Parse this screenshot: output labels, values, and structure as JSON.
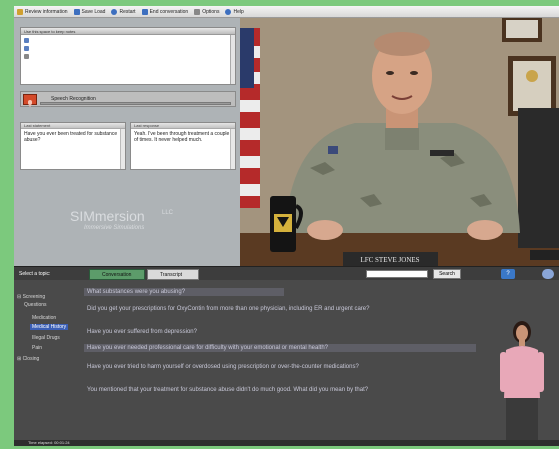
{
  "toolbar": {
    "items": [
      {
        "label": "Review information",
        "icon": "document-icon",
        "color": "#d0a030"
      },
      {
        "label": "Save Load",
        "icon": "disk-icon",
        "color": "#3d6fbf"
      },
      {
        "label": "Restart",
        "icon": "refresh-icon",
        "color": "#3d6fbf"
      },
      {
        "label": "End conversation",
        "icon": "stop-icon",
        "color": "#3d6fbf"
      },
      {
        "label": "Options",
        "icon": "wrench-icon",
        "color": "#888888"
      },
      {
        "label": "Help",
        "icon": "help-icon",
        "color": "#3d6fbf"
      }
    ]
  },
  "notes": {
    "header": "Use this space to keep notes"
  },
  "speech": {
    "label": "Speech Recognition"
  },
  "last_said": {
    "user_header": "Last statement",
    "user_text": "Have you ever been treated for substance abuse?",
    "char_header": "Last response",
    "char_text": "Yeah. I've been through treatment a couple of times. It never helped much."
  },
  "logo": {
    "name": "SIMmersion",
    "suffix": "LLC",
    "tagline": "Immersive Simulations"
  },
  "video": {
    "nameplate": "LFC STEVE JONES"
  },
  "dialog": {
    "topic_label": "Select a topic:",
    "tabs": [
      "Conversation",
      "Transcript"
    ],
    "search_label": "Search",
    "help_label": "?"
  },
  "tree": {
    "items": [
      {
        "label": "⊟ Screening"
      },
      {
        "label": "Questions"
      },
      {
        "label": "Medication"
      },
      {
        "label": "Medical History"
      },
      {
        "label": "Illegal Drugs"
      },
      {
        "label": "Pain"
      },
      {
        "label": "⊞ Closing"
      }
    ]
  },
  "questions": [
    "What substances were you abusing?",
    "Did you get your prescriptions for OxyContin from more than one physician, including ER and urgent care?",
    "Have you ever suffered from depression?",
    "Have you ever needed professional care for difficulty with your emotional or mental health?",
    "Have you ever tried to harm yourself or overdosed using prescription or over-the-counter medications?",
    "You mentioned that your treatment for substance abuse didn't do much good. What did you mean by that?"
  ],
  "status": {
    "time_label": "Time elapsed: 00:01:24"
  }
}
